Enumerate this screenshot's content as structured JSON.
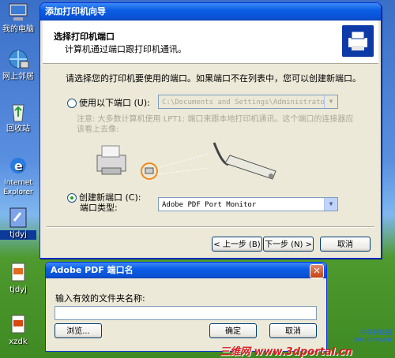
{
  "desktop": {
    "icons": [
      {
        "label": "我的电脑",
        "icon": "my-computer-icon"
      },
      {
        "label": "网上邻居",
        "icon": "network-icon"
      },
      {
        "label": "回收站",
        "icon": "recycle-bin-icon"
      },
      {
        "label": "Internet Explorer",
        "icon": "ie-icon"
      },
      {
        "label": "tjdyj",
        "icon": "shortcut-icon"
      },
      {
        "label": "tjdyj",
        "icon": "document-icon"
      },
      {
        "label": "xzdk",
        "icon": "document-icon"
      }
    ]
  },
  "wizard": {
    "title": "添加打印机向导",
    "header_title": "选择打印机端口",
    "header_subtitle": "计算机通过端口跟打印机通讯。",
    "instruction": "请选择您的打印机要使用的端口。如果端口不在列表中，您可以创建新端口。",
    "use_port_label": "使用以下端口 (U):",
    "use_port_value": "C:\\Documents and Settings\\Administrator\\",
    "note": "注意: 大多数计算机使用 LPT1: 端口来跟本地打印机通讯。这个端口的连接器应该看上去像:",
    "create_port_label": "创建新端口 (C):",
    "port_type_label": "端口类型:",
    "port_type_value": "Adobe PDF Port Monitor",
    "back_button": "< 上一步 (B)",
    "next_button": "下一步 (N) >",
    "cancel_button": "取消"
  },
  "dialog": {
    "title": "Adobe PDF 端口名",
    "prompt": "输入有效的文件夹名称:",
    "input_value": "",
    "browse_button": "浏览...",
    "ok_button": "确定",
    "cancel_button": "取消",
    "close_glyph": "✕"
  },
  "watermarks": {
    "zol_line1": "中关村在线",
    "zol_line2": "zol.com.cn",
    "site": "三维网 www.3dportal.cn"
  },
  "colors": {
    "title_blue": "#0a5fe6",
    "window_bg": "#ece9d8",
    "radio_green": "#21a121"
  }
}
